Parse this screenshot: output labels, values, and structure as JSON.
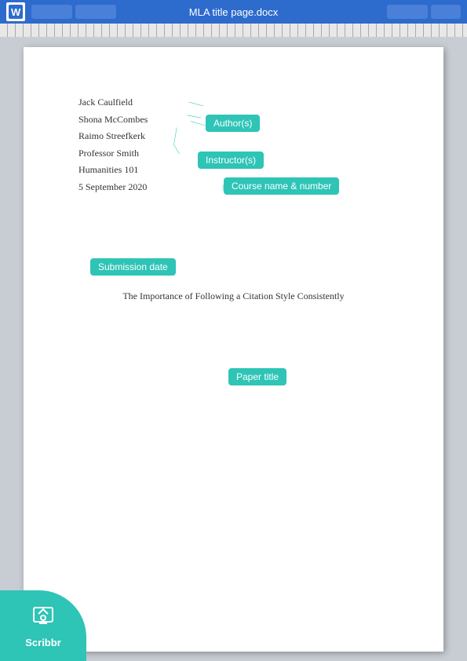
{
  "toolbar": {
    "title": "MLA title page.docx",
    "word_icon": "W",
    "buttons": [
      "btn1",
      "btn2",
      "btn3",
      "btn4"
    ]
  },
  "document": {
    "authors": [
      "Jack Caulfield",
      "Shona McCombes",
      "Raimo Streefkerk"
    ],
    "instructor": "Professor Smith",
    "course": "Humanities 101",
    "date": "5 September 2020",
    "paper_title": "The Importance of Following a Citation Style Consistently"
  },
  "annotations": {
    "authors_label": "Author(s)",
    "instructor_label": "Instructor(s)",
    "course_label": "Course name & number",
    "date_label": "Submission date",
    "title_label": "Paper title"
  },
  "logo": {
    "name": "Scribbr",
    "icon": "🎓"
  }
}
